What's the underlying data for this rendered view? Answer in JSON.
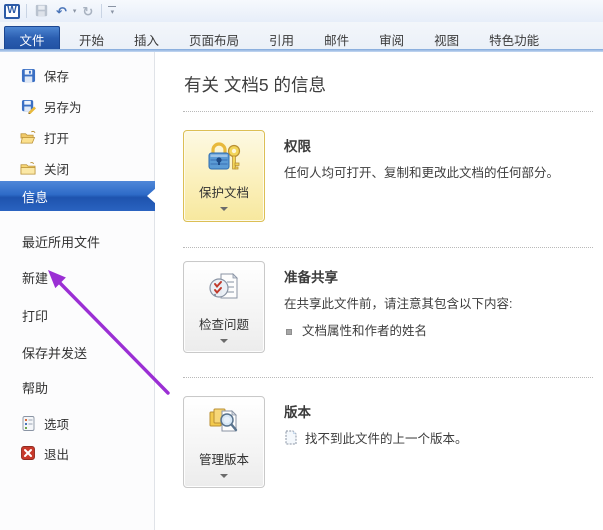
{
  "titlebar": {
    "icons": [
      {
        "name": "word-logo",
        "glyph": "W"
      },
      {
        "name": "save-icon"
      },
      {
        "name": "undo-icon",
        "glyph": "↶"
      },
      {
        "name": "undo-dropdown",
        "glyph": "▾"
      },
      {
        "name": "redo-icon",
        "glyph": "↻"
      },
      {
        "name": "customize-quick-access-icon",
        "glyph": "▾"
      }
    ]
  },
  "ribbon": {
    "tabs": [
      {
        "label": "文件",
        "active": true
      },
      {
        "label": "开始"
      },
      {
        "label": "插入"
      },
      {
        "label": "页面布局"
      },
      {
        "label": "引用"
      },
      {
        "label": "邮件"
      },
      {
        "label": "审阅"
      },
      {
        "label": "视图"
      },
      {
        "label": "特色功能"
      }
    ]
  },
  "sidebar": {
    "top_items": [
      {
        "label": "保存",
        "icon": "save-icon"
      },
      {
        "label": "另存为",
        "icon": "save-as-icon"
      },
      {
        "label": "打开",
        "icon": "open-folder-icon"
      },
      {
        "label": "关闭",
        "icon": "close-folder-icon"
      }
    ],
    "menu_items": [
      {
        "label": "信息",
        "selected": true
      },
      {
        "label": "最近所用文件"
      },
      {
        "label": "新建"
      },
      {
        "label": "打印"
      },
      {
        "label": "保存并发送"
      },
      {
        "label": "帮助"
      }
    ],
    "bottom_items": [
      {
        "label": "选项",
        "icon": "options-icon"
      },
      {
        "label": "退出",
        "icon": "exit-icon"
      }
    ]
  },
  "content": {
    "title": "有关 文档5 的信息",
    "sections": [
      {
        "heading": "权限",
        "button_label": "保护文档",
        "button_icon": "protect-document-icon",
        "description": "任何人均可打开、复制和更改此文档的任何部分。"
      },
      {
        "heading": "准备共享",
        "button_label": "检查问题",
        "button_icon": "check-for-issues-icon",
        "description": "在共享此文件前，请注意其包含以下内容:",
        "bullet": "文档属性和作者的姓名"
      },
      {
        "heading": "版本",
        "button_label": "管理版本",
        "button_icon": "manage-versions-icon",
        "description": "找不到此文件的上一个版本。"
      }
    ]
  },
  "annotation": {
    "type": "arrow",
    "points_to": "新建",
    "color": "#9b2fd4"
  },
  "colors": {
    "file_tab_blue": "#2a5db0",
    "selected_item_blue": "#2e6bc8",
    "protect_button_yellow": "#f7e89e",
    "annotation_purple": "#9b2fd4"
  }
}
